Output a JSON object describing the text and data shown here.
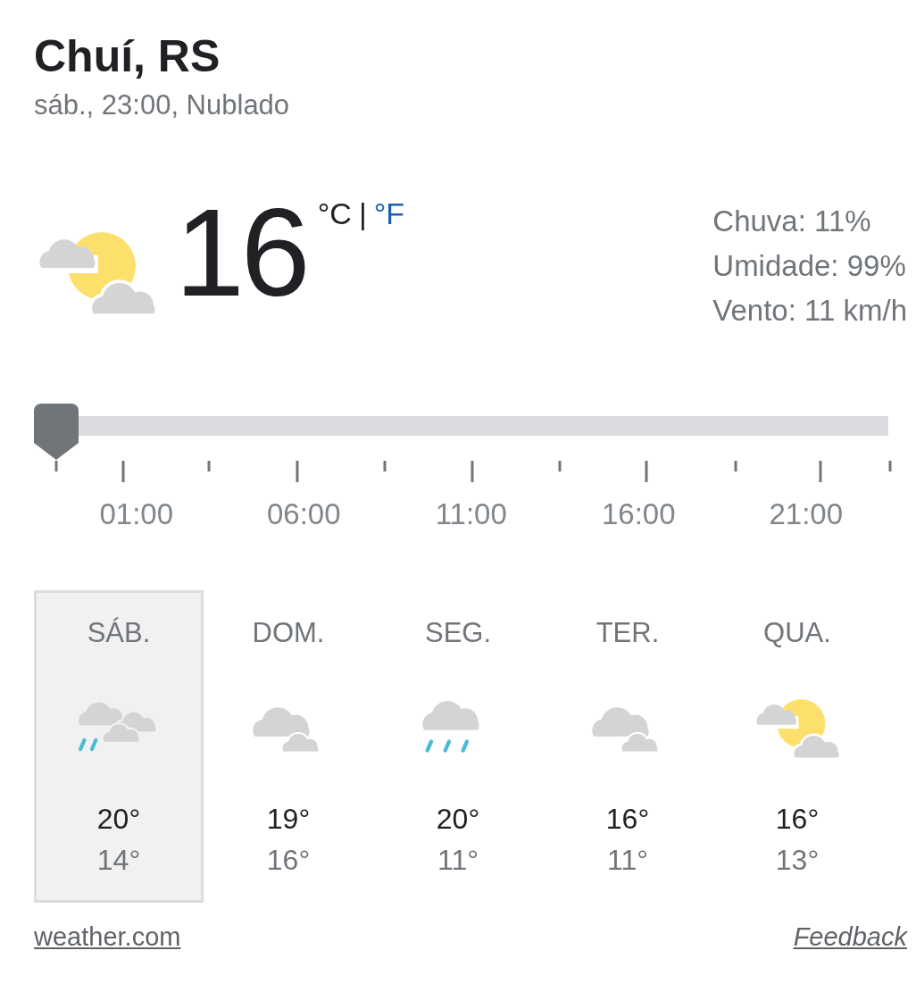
{
  "location": {
    "title": "Chuí, RS",
    "subtitle": "sáb., 23:00, Nublado"
  },
  "current": {
    "kind": "sun-cloud",
    "temperature": "16",
    "units": [
      {
        "label": "°C",
        "selected": true
      },
      {
        "label": "°F",
        "selected": false
      }
    ],
    "separator": "|",
    "details": [
      "Chuva: 11%",
      "Umidade: 99%",
      "Vento: 11 km/h"
    ]
  },
  "timeline": {
    "level": 0,
    "labels": [
      "01:00",
      "06:00",
      "11:00",
      "16:00",
      "21:00"
    ]
  },
  "days": [
    {
      "name": "SÁB.",
      "kind": "rain-clouds",
      "high": "20°",
      "low": "14°",
      "selected": true
    },
    {
      "name": "DOM.",
      "kind": "clouds",
      "high": "19°",
      "low": "16°",
      "selected": false
    },
    {
      "name": "SEG.",
      "kind": "rain",
      "high": "20°",
      "low": "11°",
      "selected": false
    },
    {
      "name": "TER.",
      "kind": "clouds",
      "high": "16°",
      "low": "11°",
      "selected": false
    },
    {
      "name": "QUA.",
      "kind": "sun-cloud",
      "high": "16°",
      "low": "13°",
      "selected": false
    }
  ],
  "footer": {
    "source": "weather.com",
    "feedback": "Feedback"
  }
}
